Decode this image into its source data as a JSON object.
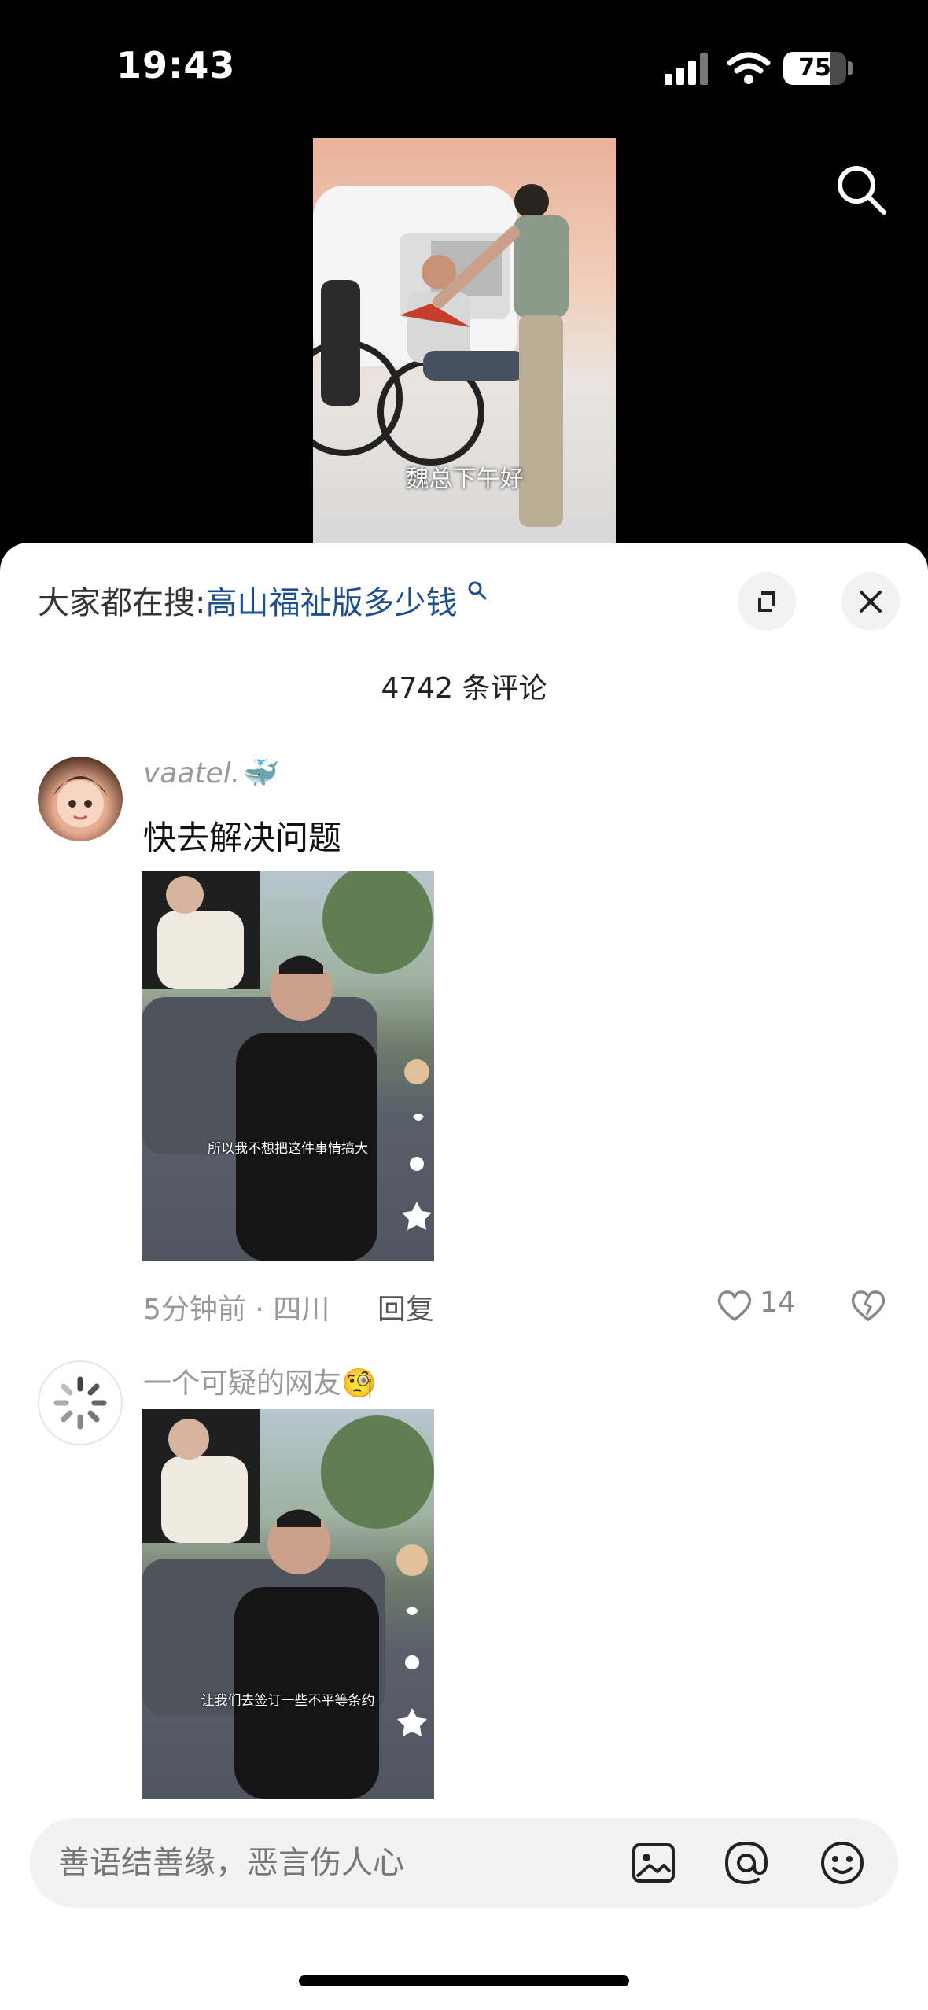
{
  "status_bar": {
    "time": "19:43",
    "battery": "75",
    "battery_level": 0.75
  },
  "video": {
    "subtitle": "魏总下午好"
  },
  "sheet": {
    "trending_prefix": "大家都在搜:",
    "trending_query": "高山福祉版多少钱",
    "comment_count": "4742 条评论"
  },
  "comments": [
    {
      "username": "vaatel.",
      "username_emoji": "🐳",
      "text": "快去解决问题",
      "thumb_subtitle": "所以我不想把这件事情搞大",
      "meta": "5分钟前 · 四川",
      "reply_label": "回复",
      "like_count": "14"
    },
    {
      "username": "一个可疑的网友",
      "username_emoji": "🧐",
      "thumb_subtitle": "让我们去签订一些不平等条约"
    }
  ],
  "input": {
    "placeholder": "善语结善缘，恶言伤人心"
  },
  "icons": {
    "search": "search-icon",
    "expand": "expand-icon",
    "close": "close-icon",
    "like": "heart-icon",
    "dislike": "broken-heart-icon",
    "image": "image-icon",
    "at": "at-icon",
    "emoji": "emoji-icon"
  },
  "colors": {
    "accent_link": "#1f4e8c",
    "sheet_bg": "#ffffff",
    "backdrop": "#000000"
  }
}
